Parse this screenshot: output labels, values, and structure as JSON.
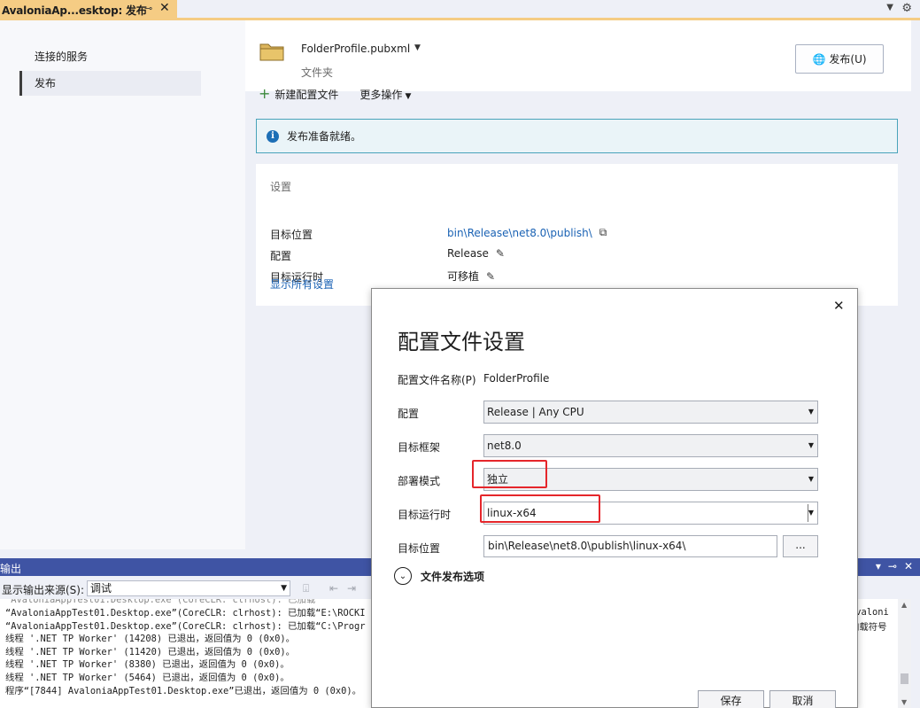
{
  "doc_tab": {
    "title": "AvaloniaAp...esktop: 发布",
    "pin_glyph": "⊸",
    "close_glyph": "✕"
  },
  "left_nav": {
    "items": [
      {
        "label": "连接的服务",
        "selected": false
      },
      {
        "label": "发布",
        "selected": true
      }
    ]
  },
  "header": {
    "profile_name": "FolderProfile.pubxml",
    "profile_type": "文件夹",
    "publish_button": "发布(U)"
  },
  "toolbar": {
    "new_profile": "新建配置文件",
    "more_actions": "更多操作"
  },
  "info_bar": {
    "message": "发布准备就绪。"
  },
  "settings": {
    "title": "设置",
    "rows": [
      {
        "key": "目标位置",
        "value": "bin\\Release\\net8.0\\publish\\"
      },
      {
        "key": "配置",
        "value": "Release"
      },
      {
        "key": "目标运行时",
        "value": "可移植"
      }
    ],
    "show_all": "显示所有设置"
  },
  "output": {
    "title": "输出",
    "source_label": "显示输出来源(S):",
    "source_value": "调试",
    "lines": [
      "“AvaloniaAppTest01.Desktop.exe”(CoreCLR: clrhost): 已加载“E:\\ROCKI",
      "“AvaloniaAppTest01.Desktop.exe”(CoreCLR: clrhost): 已加载“C:\\Progr",
      "线程 '.NET TP Worker' (14208) 已退出，返回值为 0 (0x0)。",
      "线程 '.NET TP Worker' (11420) 已退出，返回值为 0 (0x0)。",
      "线程 '.NET TP Worker' (8380) 已退出，返回值为 0 (0x0)。",
      "线程 '.NET TP Worker' (5464) 已退出，返回值为 0 (0x0)。",
      "程序“[7844] AvaloniaAppTest01.Desktop.exe”已退出，返回值为 0 (0x0)。"
    ],
    "overflow_right": [
      "Avaloni",
      "加载符号"
    ]
  },
  "dialog": {
    "title": "配置文件设置",
    "profile_name_label": "配置文件名称(P)",
    "profile_name_value": "FolderProfile",
    "configuration_label": "配置",
    "configuration_value": "Release | Any CPU",
    "framework_label": "目标框架",
    "framework_value": "net8.0",
    "deploy_mode_label": "部署模式",
    "deploy_mode_value": "独立",
    "runtime_label": "目标运行时",
    "runtime_value": "linux-x64",
    "target_location_label": "目标位置",
    "target_location_value": "bin\\Release\\net8.0\\publish\\linux-x64\\",
    "browse_label": "...",
    "file_publish_options": "文件发布选项",
    "save_button": "保存",
    "cancel_button": "取消"
  },
  "colors": {
    "tab_accent": "#f5cc84",
    "output_title_bg": "#3f54a4",
    "link": "#1a62b4",
    "info_border": "#49a3ba",
    "annotation": "#e5262b"
  }
}
